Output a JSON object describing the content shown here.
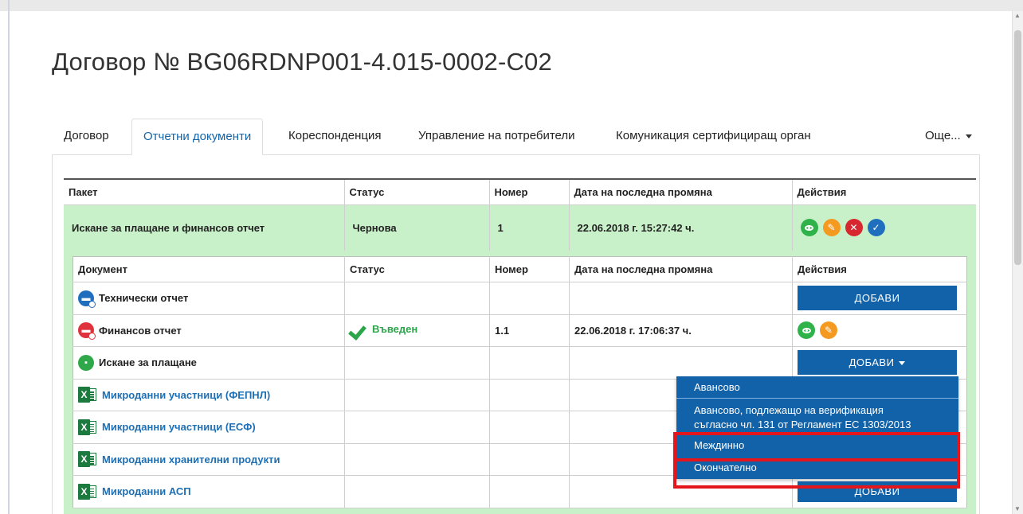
{
  "page": {
    "title": "Договор № BG06RDNP001-4.015-0002-C02"
  },
  "tabs": [
    {
      "label": "Договор",
      "active": false
    },
    {
      "label": "Отчетни документи",
      "active": true
    },
    {
      "label": "Кореспонденция",
      "active": false
    },
    {
      "label": "Управление на потребители",
      "active": false
    },
    {
      "label": "Комуникация сертифициращ орган",
      "active": false
    },
    {
      "label": "Още...",
      "active": false
    }
  ],
  "package_table": {
    "columns": [
      "Пакет",
      "Статус",
      "Номер",
      "Дата на последна промяна",
      "Действия"
    ],
    "row": {
      "package": "Искане за плащане и финансов отчет",
      "status": "Чернова",
      "number": "1",
      "date": "22.06.2018 г. 15:27:42 ч.",
      "actions": [
        "view-icon",
        "edit-icon",
        "delete-icon",
        "approve-icon"
      ]
    }
  },
  "documents_table": {
    "columns": [
      "Документ",
      "Статус",
      "Номер",
      "Дата на последна промяна",
      "Действия"
    ],
    "rows": [
      {
        "name": "Технически отчет",
        "icon": "technical-report-icon",
        "status": "",
        "number": "",
        "date": "",
        "action": "ДОБАВИ"
      },
      {
        "name": "Финансов отчет",
        "icon": "financial-report-icon",
        "status": "Въведен",
        "number": "1.1",
        "date": "22.06.2018 г. 17:06:37 ч.",
        "action": ""
      },
      {
        "name": "Искане за плащане",
        "icon": "payment-request-icon",
        "status": "",
        "number": "",
        "date": "",
        "action": "ДОБАВИ"
      },
      {
        "name": "Микроданни участници (ФЕПНЛ)",
        "icon": "excel-icon",
        "status": "",
        "number": "",
        "date": "",
        "action": ""
      },
      {
        "name": "Микроданни участници (ЕСФ)",
        "icon": "excel-icon",
        "status": "",
        "number": "",
        "date": "",
        "action": ""
      },
      {
        "name": "Микроданни хранителни продукти",
        "icon": "excel-icon",
        "status": "",
        "number": "",
        "date": "",
        "action": ""
      },
      {
        "name": "Микроданни АСП",
        "icon": "excel-icon",
        "status": "",
        "number": "",
        "date": "",
        "action": "ДОБАВИ"
      }
    ]
  },
  "dropdown": {
    "items": [
      {
        "line1": "Авансово",
        "line2": ""
      },
      {
        "line1": "Авансово, подлежащо на верификация",
        "line2": "съгласно чл. 131 от Регламент ЕС 1303/2013"
      },
      {
        "line1": "Междинно",
        "line2": ""
      },
      {
        "line1": "Окончателно",
        "line2": ""
      }
    ]
  },
  "colors": {
    "accent": "#1262a9",
    "row_highlight": "#c9f1c9",
    "status_ok": "#2ba54a",
    "annotation": "#e4161c"
  }
}
